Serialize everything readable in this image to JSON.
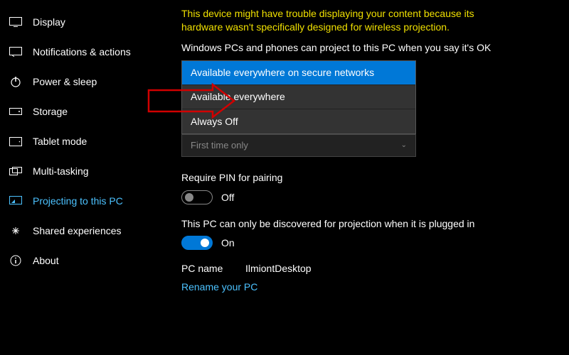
{
  "sidebar": {
    "items": [
      {
        "label": "Display",
        "icon": "display-icon"
      },
      {
        "label": "Notifications & actions",
        "icon": "notifications-icon"
      },
      {
        "label": "Power & sleep",
        "icon": "power-icon"
      },
      {
        "label": "Storage",
        "icon": "storage-icon"
      },
      {
        "label": "Tablet mode",
        "icon": "tablet-icon"
      },
      {
        "label": "Multi-tasking",
        "icon": "multitasking-icon"
      },
      {
        "label": "Projecting to this PC",
        "icon": "projecting-icon",
        "active": true
      },
      {
        "label": "Shared experiences",
        "icon": "shared-icon"
      },
      {
        "label": "About",
        "icon": "about-icon"
      }
    ]
  },
  "main": {
    "warning": "This device might have trouble displaying your content because its hardware wasn't specifically designed for wireless projection.",
    "project_label": "Windows PCs and phones can project to this PC when you say it's OK",
    "dropdown": {
      "options": [
        "Available everywhere on secure networks",
        "Available everywhere",
        "Always Off"
      ],
      "selected_index": 0
    },
    "ask_select": {
      "value": "First time only"
    },
    "pin": {
      "label": "Require PIN for pairing",
      "state_label": "Off",
      "on": false
    },
    "discover": {
      "label": "This PC can only be discovered for projection when it is plugged in",
      "state_label": "On",
      "on": true
    },
    "pcname": {
      "label": "PC name",
      "value": "IlmiontDesktop"
    },
    "rename_link": "Rename your PC"
  },
  "colors": {
    "accent": "#0078d7",
    "link": "#4cc2ff",
    "warning": "#f0e000",
    "annotation": "#d10000"
  }
}
